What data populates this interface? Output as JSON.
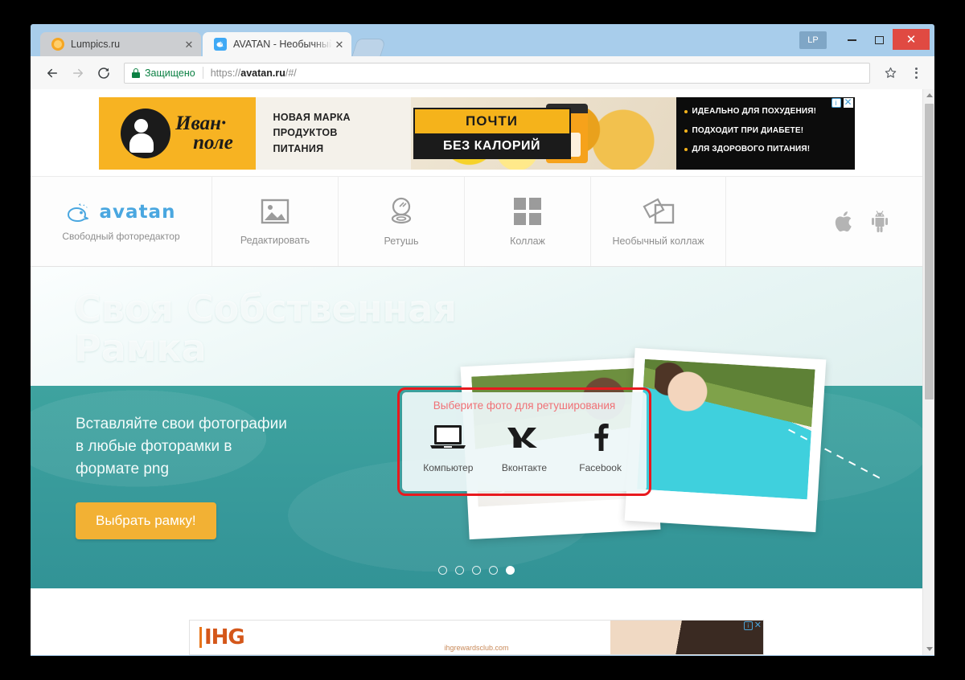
{
  "browser": {
    "tabs": [
      {
        "title": "Lumpics.ru",
        "favicon": "orange-dot-icon",
        "active": false
      },
      {
        "title": "AVATAN - Необычный с",
        "favicon": "avatan-whale-icon",
        "active": true
      }
    ],
    "new_tab_label": "",
    "window_controls": {
      "profile_badge": "LP",
      "minimize": "minimize-icon",
      "maximize": "maximize-icon",
      "close": "✕"
    },
    "toolbar": {
      "back": "back-arrow-icon",
      "forward": "forward-arrow-icon",
      "reload": "reload-icon",
      "security_label": "Защищено",
      "url_prefix": "https://",
      "url_domain": "avatan.ru",
      "url_path": "/#/",
      "bookmark": "star-icon",
      "menu": "three-dot-menu-icon"
    }
  },
  "top_ad": {
    "brand_line1": "Иван·",
    "brand_line2": "поле",
    "headline": "НОВАЯ МАРКА\nПРОДУКТОВ\nПИТАНИЯ",
    "promo_top": "ПОЧТИ",
    "promo_bottom": "БЕЗ КАЛОРИЙ",
    "bullets": [
      "ИДЕАЛЬНО ДЛЯ ПОХУДЕНИЯ!",
      "ПОДХОДИТ ПРИ ДИАБЕТЕ!",
      "ДЛЯ ЗДОРОВОГО ПИТАНИЯ!"
    ],
    "adchoices": "i",
    "close": "✕"
  },
  "site_nav": {
    "logo_text": "avatan",
    "tagline": "Свободный фоторедактор",
    "items": [
      {
        "label": "Редактировать",
        "icon": "image-icon"
      },
      {
        "label": "Ретушь",
        "icon": "compact-mirror-icon"
      },
      {
        "label": "Коллаж",
        "icon": "grid-four-squares-icon"
      },
      {
        "label": "Необычный коллаж",
        "icon": "overlapping-frames-icon"
      }
    ],
    "platforms": [
      {
        "name": "apple-icon"
      },
      {
        "name": "android-icon"
      }
    ]
  },
  "hero": {
    "title": "Своя Собственная\nРамка",
    "subtitle": "Вставляйте свои фотографии\nв любые фоторамки в\nформате png",
    "cta_label": "Выбрать рамку!",
    "carousel": {
      "total": 5,
      "active_index": 4
    }
  },
  "retouch_dialog": {
    "title": "Выберите фото для ретуширования",
    "options": [
      {
        "label": "Компьютер",
        "icon": "laptop-icon"
      },
      {
        "label": "Вконтакте",
        "icon": "vk-icon"
      },
      {
        "label": "Facebook",
        "icon": "facebook-icon"
      }
    ],
    "highlight_color": "#e8191e"
  },
  "bottom_ad": {
    "brand": "IHG",
    "site": "ihgrewardsclub.com",
    "adchoices": "i",
    "close": "✕"
  },
  "colors": {
    "chrome_frame": "#a8cdeb",
    "teal": "#37999a",
    "cta_orange": "#f2b134",
    "avatan_blue": "#4aa7e0",
    "annotation_red": "#e8191e"
  }
}
